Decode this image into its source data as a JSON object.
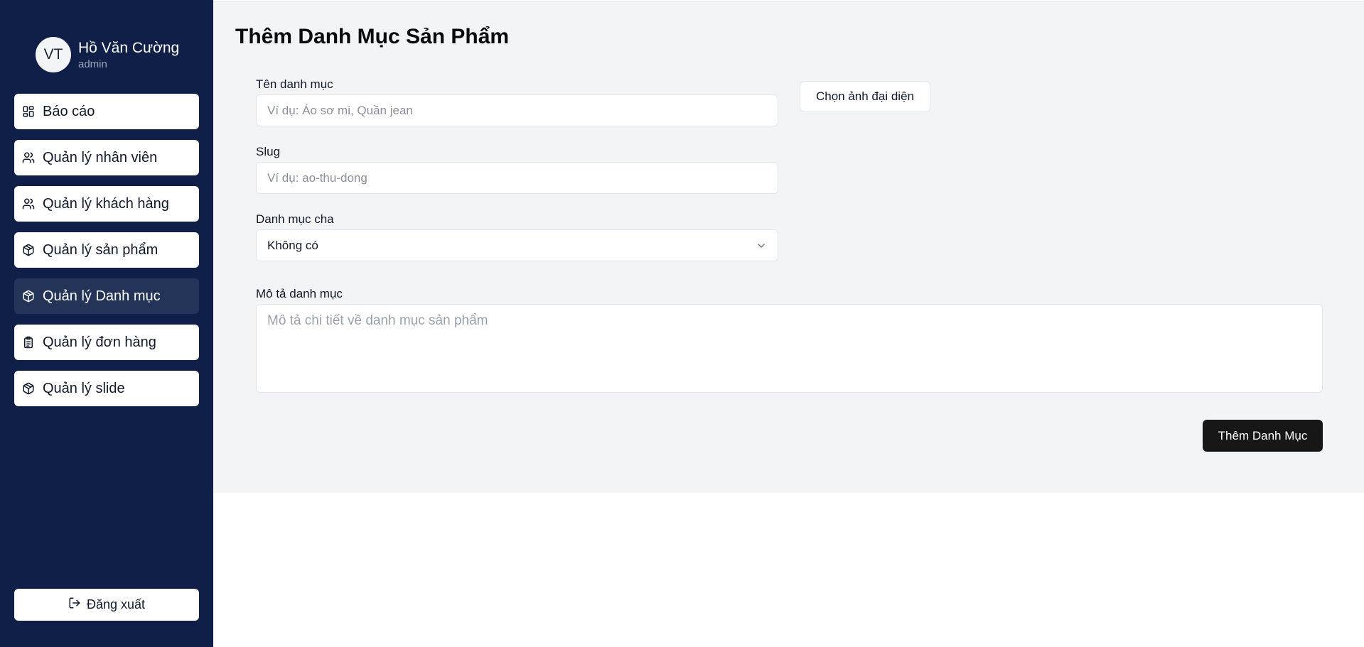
{
  "user": {
    "initials": "VT",
    "name": "Hồ Văn Cường",
    "role": "admin"
  },
  "sidebar": {
    "items": [
      {
        "label": "Báo cáo",
        "icon": "dashboard-icon"
      },
      {
        "label": "Quản lý nhân viên",
        "icon": "users-icon"
      },
      {
        "label": "Quản lý khách hàng",
        "icon": "users-icon"
      },
      {
        "label": "Quản lý sản phẩm",
        "icon": "package-icon"
      },
      {
        "label": "Quản lý Danh mục",
        "icon": "package-icon",
        "active": true
      },
      {
        "label": "Quản lý đơn hàng",
        "icon": "clipboard-icon"
      },
      {
        "label": "Quản lý slide",
        "icon": "package-icon"
      }
    ],
    "logout_label": "Đăng xuất"
  },
  "form": {
    "title": "Thêm Danh Mục Sản Phẩm",
    "name_label": "Tên danh mục",
    "name_placeholder": "Ví dụ: Áo sơ mi, Quần jean",
    "slug_label": "Slug",
    "slug_placeholder": "Ví dụ: ao-thu-dong",
    "parent_label": "Danh mục cha",
    "parent_value": "Không có",
    "description_label": "Mô tả danh mục",
    "description_placeholder": "Mô tả chi tiết về danh mục sản phẩm",
    "image_button": "Chọn ảnh đại diện",
    "submit_button": "Thêm Danh Mục"
  },
  "colors": {
    "sidebar_bg": "#0f1f47",
    "active_item_bg": "#243459",
    "main_bg": "#f3f4f6",
    "primary_button": "#171717"
  }
}
